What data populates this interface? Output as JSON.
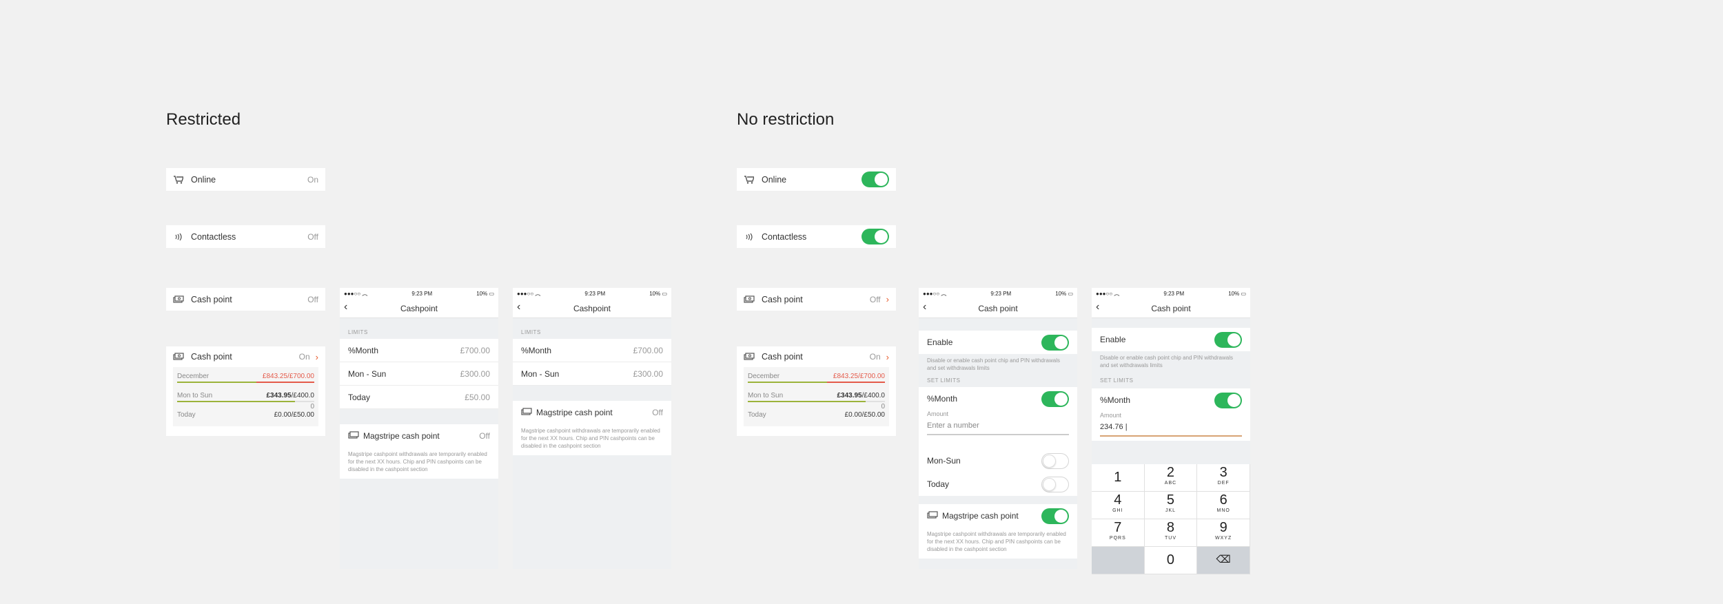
{
  "headings": {
    "restricted": "Restricted",
    "no_restriction": "No restriction"
  },
  "restricted": {
    "online": {
      "label": "Online",
      "value": "On"
    },
    "contactless": {
      "label": "Contactless",
      "value": "Off"
    },
    "cashpoint": {
      "label": "Cash point",
      "value": "Off"
    },
    "cashpoint_expanded": {
      "label": "Cash point",
      "value": "On",
      "rows": [
        {
          "label": "December",
          "spent": "£843.25",
          "limit": "/£700.00",
          "progress": 1.0
        },
        {
          "label": "Mon to Sun",
          "spent": "£343.95",
          "limit": "/£400.0",
          "extra": "0",
          "progress": 0.86
        },
        {
          "label": "Today",
          "spent": "£0.00",
          "limit": "/£50.00",
          "progress": 0
        }
      ]
    }
  },
  "norestr": {
    "online": {
      "label": "Online",
      "toggle": true
    },
    "contactless": {
      "label": "Contactless",
      "toggle": true
    },
    "cashpoint": {
      "label": "Cash point",
      "value": "Off"
    },
    "cashpoint_expanded": {
      "label": "Cash point",
      "value": "On",
      "rows": [
        {
          "label": "December",
          "spent": "£843.25",
          "limit": "/£700.00",
          "progress": 1.0
        },
        {
          "label": "Mon to Sun",
          "spent": "£343.95",
          "limit": "/£400.0",
          "extra": "0",
          "progress": 0.86
        },
        {
          "label": "Today",
          "spent": "£0.00",
          "limit": "/£50.00",
          "progress": 0
        }
      ]
    }
  },
  "status": {
    "time": "9:23 PM",
    "battery": "10%",
    "signal": "●●●○○"
  },
  "phone1": {
    "title": "Cashpoint",
    "limits_label": "LIMITS",
    "rows": [
      {
        "label": "%Month",
        "value": "£700.00"
      },
      {
        "label": "Mon - Sun",
        "value": "£300.00"
      },
      {
        "label": "Today",
        "value": "£50.00"
      }
    ],
    "magstripe": {
      "label": "Magstripe cash point",
      "value": "Off",
      "desc": "Magstripe cashpoint withdrawals are temporarily enabled for the next XX hours. Chip and PIN cashpoints can be disabled in the cashpoint section"
    }
  },
  "phone2": {
    "title": "Cashpoint",
    "limits_label": "LIMITS",
    "rows": [
      {
        "label": "%Month",
        "value": "£700.00"
      },
      {
        "label": "Mon - Sun",
        "value": "£300.00"
      }
    ],
    "magstripe": {
      "label": "Magstripe cash point",
      "value": "Off",
      "desc": "Magstripe cashpoint withdrawals are temporarily enabled for the next XX hours. Chip and PIN cashpoints can be disabled in the cashpoint section"
    }
  },
  "phone3": {
    "title": "Cash point",
    "enable": "Enable",
    "enable_desc": "Disable or enable cash point chip and PIN withdrawals and set withdrawals limits",
    "set_limits": "SET LIMITS",
    "month": "%Month",
    "amount_label": "Amount",
    "amount_placeholder": "Enter a number",
    "monsun": "Mon-Sun",
    "today": "Today",
    "magstripe": "Magstripe cash point",
    "magstripe_desc": "Magstripe cashpoint withdrawals are temporarily enabled for the next XX hours. Chip and PIN cashpoints can be disabled in the cashpoint section"
  },
  "phone4": {
    "title": "Cash point",
    "enable": "Enable",
    "enable_desc": "Disable or enable cash point chip and PIN withdrawals and set withdrawals limits",
    "set_limits": "SET LIMITS",
    "month": "%Month",
    "amount_label": "Amount",
    "amount_value": "234.76",
    "keys": [
      {
        "n": "1",
        "s": ""
      },
      {
        "n": "2",
        "s": "ABC"
      },
      {
        "n": "3",
        "s": "DEF"
      },
      {
        "n": "4",
        "s": "GHI"
      },
      {
        "n": "5",
        "s": "JKL"
      },
      {
        "n": "6",
        "s": "MNO"
      },
      {
        "n": "7",
        "s": "PQRS"
      },
      {
        "n": "8",
        "s": "TUV"
      },
      {
        "n": "9",
        "s": "WXYZ"
      },
      {
        "n": "",
        "s": ""
      },
      {
        "n": "0",
        "s": ""
      },
      {
        "n": "⌫",
        "s": ""
      }
    ]
  },
  "colors": {
    "green": "#2db65b",
    "orange": "#e85a2a",
    "red_text": "#e45a4a",
    "olive": "#9bb33a"
  }
}
